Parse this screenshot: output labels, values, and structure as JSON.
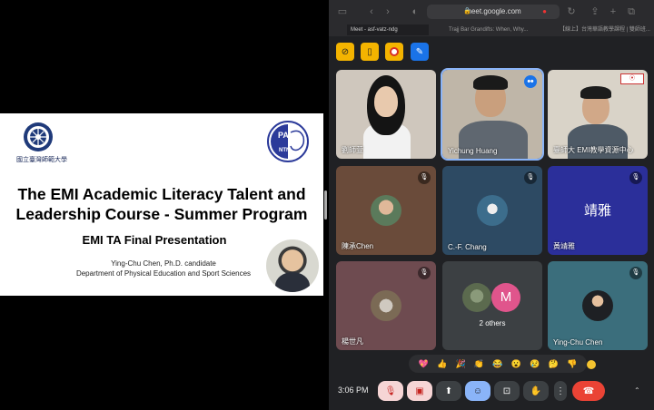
{
  "slide": {
    "university_name": "國立臺灣師範大學",
    "partner_logo_text": "PACN",
    "partner_logo_sub": "NTNU",
    "title_line1": "The EMI Academic Literacy Talent and",
    "title_line2": "Leadership Course - Summer Program",
    "subtitle": "EMI TA Final Presentation",
    "author": "Ying-Chu Chen, Ph.D. candidate",
    "department": "Department of Physical Education and Sport Sciences"
  },
  "browser": {
    "url": "meet.google.com",
    "tabs": [
      {
        "label": "Meet - asf-vatz-ndg",
        "active": true
      },
      {
        "label": "Trajj Bar Grandifts: When, Why...",
        "active": false
      },
      {
        "label": "【線上】台灣華語教學課程 | 雙師班...",
        "active": false
      }
    ]
  },
  "participants": [
    {
      "name": "劉師萱",
      "muted": false,
      "speaking": false
    },
    {
      "name": "Yichung Huang",
      "muted": false,
      "speaking": true
    },
    {
      "name": "臺師大 EMI教學資源中心",
      "muted": false,
      "speaking": false
    },
    {
      "name": "陳承Chen",
      "muted": true,
      "speaking": false
    },
    {
      "name": "C.-F. Chang",
      "muted": true,
      "speaking": false
    },
    {
      "name": "黃靖雅",
      "muted": true,
      "speaking": false,
      "avatar_text": "靖雅"
    },
    {
      "name": "楊世凡",
      "muted": true,
      "speaking": false
    },
    {
      "name": "2 others",
      "muted": false,
      "speaking": false,
      "avatar_letter": "M"
    },
    {
      "name": "Ying-Chu Chen",
      "muted": true,
      "speaking": false
    }
  ],
  "reactions": [
    "💖",
    "👍",
    "🎉",
    "👏",
    "😂",
    "😮",
    "😢",
    "🤔",
    "👎"
  ],
  "controls": {
    "time": "3:06 PM"
  },
  "colors": {
    "meet_bg": "#202124",
    "tile_bg": "#3c4043",
    "accent_yellow": "#f4b400",
    "end_call_red": "#ea4335",
    "speaking_outline": "#8ab4f8"
  }
}
